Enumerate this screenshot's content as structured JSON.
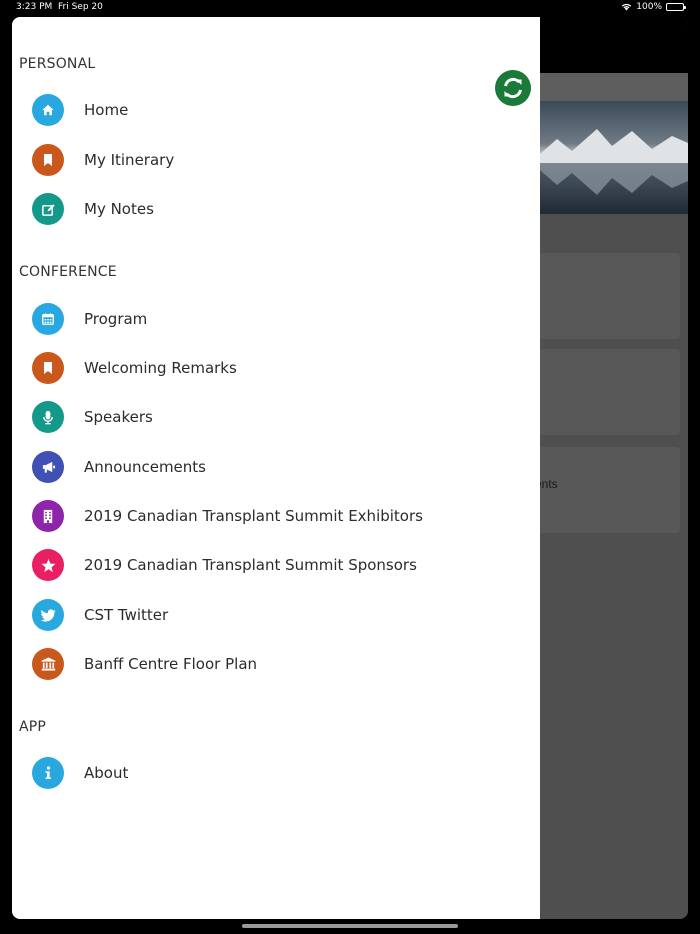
{
  "status_bar": {
    "time": "3:23 PM",
    "date": "Fri Sep 20",
    "battery": "100%",
    "battery_level": 1.0
  },
  "background": {
    "partial_text": "ents"
  },
  "colors": {
    "blue": "#29a8e0",
    "orange": "#c8581b",
    "teal": "#14988a",
    "indigo": "#3f51b5",
    "purple": "#8e24aa",
    "pink": "#e91e63",
    "refresh_green": "#1b7a3a"
  },
  "sections": {
    "personal": {
      "title": "PERSONAL",
      "items": [
        {
          "label": "Home",
          "icon": "home-icon"
        },
        {
          "label": "My Itinerary",
          "icon": "bookmark-icon"
        },
        {
          "label": "My Notes",
          "icon": "edit-icon"
        }
      ]
    },
    "conference": {
      "title": "CONFERENCE",
      "items": [
        {
          "label": "Program",
          "icon": "calendar-icon"
        },
        {
          "label": "Welcoming Remarks",
          "icon": "bookmark-icon"
        },
        {
          "label": "Speakers",
          "icon": "microphone-icon"
        },
        {
          "label": "Announcements",
          "icon": "megaphone-icon"
        },
        {
          "label": "2019 Canadian Transplant Summit Exhibitors",
          "icon": "building-icon"
        },
        {
          "label": "2019 Canadian Transplant Summit Sponsors",
          "icon": "star-icon"
        },
        {
          "label": "CST Twitter",
          "icon": "twitter-icon"
        },
        {
          "label": "Banff Centre Floor Plan",
          "icon": "institution-icon"
        }
      ]
    },
    "app": {
      "title": "APP",
      "items": [
        {
          "label": "About",
          "icon": "info-icon"
        }
      ]
    }
  }
}
